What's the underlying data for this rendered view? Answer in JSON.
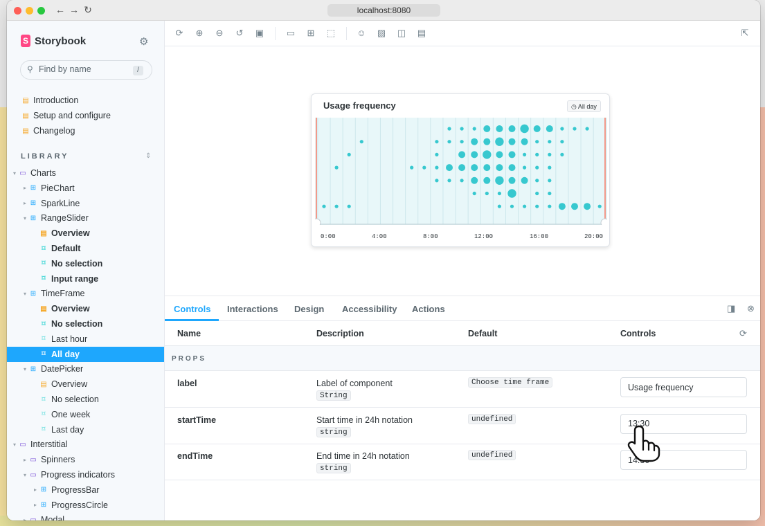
{
  "browser": {
    "url": "localhost:8080"
  },
  "sidebar": {
    "brand": "Storybook",
    "search_placeholder": "Find by name",
    "search_shortcut": "/",
    "docs": [
      {
        "label": "Introduction"
      },
      {
        "label": "Setup and configure"
      },
      {
        "label": "Changelog"
      }
    ],
    "library_header": "LIBRARY",
    "tree": [
      {
        "label": "Charts",
        "kind": "folder",
        "depth": 0,
        "expanded": true
      },
      {
        "label": "PieChart",
        "kind": "component",
        "depth": 1,
        "expanded": false
      },
      {
        "label": "SparkLine",
        "kind": "component",
        "depth": 1,
        "expanded": false
      },
      {
        "label": "RangeSlider",
        "kind": "component",
        "depth": 1,
        "expanded": true
      },
      {
        "label": "Overview",
        "kind": "doc",
        "depth": 2,
        "bold": true
      },
      {
        "label": "Default",
        "kind": "story",
        "depth": 2,
        "bold": true
      },
      {
        "label": "No selection",
        "kind": "story",
        "depth": 2,
        "bold": true
      },
      {
        "label": "Input range",
        "kind": "story",
        "depth": 2,
        "bold": true
      },
      {
        "label": "TimeFrame",
        "kind": "component",
        "depth": 1,
        "expanded": true
      },
      {
        "label": "Overview",
        "kind": "doc",
        "depth": 2,
        "bold": true
      },
      {
        "label": "No selection",
        "kind": "story",
        "depth": 2,
        "bold": true
      },
      {
        "label": "Last hour",
        "kind": "story",
        "depth": 2
      },
      {
        "label": "All day",
        "kind": "story",
        "depth": 2,
        "selected": true
      },
      {
        "label": "DatePicker",
        "kind": "component",
        "depth": 1,
        "expanded": true
      },
      {
        "label": "Overview",
        "kind": "doc",
        "depth": 2
      },
      {
        "label": "No selection",
        "kind": "story",
        "depth": 2
      },
      {
        "label": "One week",
        "kind": "story",
        "depth": 2
      },
      {
        "label": "Last day",
        "kind": "story",
        "depth": 2
      },
      {
        "label": "Interstitial",
        "kind": "folder",
        "depth": 0,
        "expanded": true
      },
      {
        "label": "Spinners",
        "kind": "folder",
        "depth": 1,
        "expanded": false
      },
      {
        "label": "Progress indicators",
        "kind": "folder",
        "depth": 1,
        "expanded": true
      },
      {
        "label": "ProgressBar",
        "kind": "component",
        "depth": 2,
        "expanded": false
      },
      {
        "label": "ProgressCircle",
        "kind": "component",
        "depth": 2,
        "expanded": false
      },
      {
        "label": "Modal",
        "kind": "folder",
        "depth": 1,
        "expanded": false
      }
    ]
  },
  "preview": {
    "card_title": "Usage frequency",
    "card_badge": "All day",
    "x_ticks": [
      "0:00",
      "4:00",
      "8:00",
      "12:00",
      "16:00",
      "20:00"
    ]
  },
  "chart_data": {
    "type": "scatter",
    "title": "Usage frequency",
    "x_unit": "hour",
    "xlim": [
      0,
      23
    ],
    "x_ticks": [
      "0:00",
      "4:00",
      "8:00",
      "12:00",
      "16:00",
      "20:00"
    ],
    "y_unit": "row",
    "rows": 7,
    "points": [
      {
        "x": 10,
        "row": 0,
        "size": 1
      },
      {
        "x": 11,
        "row": 0,
        "size": 1
      },
      {
        "x": 12,
        "row": 0,
        "size": 1
      },
      {
        "x": 13,
        "row": 0,
        "size": 2
      },
      {
        "x": 14,
        "row": 0,
        "size": 2
      },
      {
        "x": 15,
        "row": 0,
        "size": 2
      },
      {
        "x": 16,
        "row": 0,
        "size": 3
      },
      {
        "x": 17,
        "row": 0,
        "size": 2
      },
      {
        "x": 18,
        "row": 0,
        "size": 2
      },
      {
        "x": 19,
        "row": 0,
        "size": 1
      },
      {
        "x": 20,
        "row": 0,
        "size": 1
      },
      {
        "x": 21,
        "row": 0,
        "size": 1
      },
      {
        "x": 3,
        "row": 1,
        "size": 1
      },
      {
        "x": 9,
        "row": 1,
        "size": 1
      },
      {
        "x": 10,
        "row": 1,
        "size": 1
      },
      {
        "x": 11,
        "row": 1,
        "size": 1
      },
      {
        "x": 12,
        "row": 1,
        "size": 2
      },
      {
        "x": 13,
        "row": 1,
        "size": 2
      },
      {
        "x": 14,
        "row": 1,
        "size": 3
      },
      {
        "x": 15,
        "row": 1,
        "size": 2
      },
      {
        "x": 16,
        "row": 1,
        "size": 2
      },
      {
        "x": 17,
        "row": 1,
        "size": 1
      },
      {
        "x": 18,
        "row": 1,
        "size": 1
      },
      {
        "x": 19,
        "row": 1,
        "size": 1
      },
      {
        "x": 2,
        "row": 2,
        "size": 1
      },
      {
        "x": 9,
        "row": 2,
        "size": 1
      },
      {
        "x": 11,
        "row": 2,
        "size": 2
      },
      {
        "x": 12,
        "row": 2,
        "size": 2
      },
      {
        "x": 13,
        "row": 2,
        "size": 3
      },
      {
        "x": 14,
        "row": 2,
        "size": 2
      },
      {
        "x": 15,
        "row": 2,
        "size": 2
      },
      {
        "x": 16,
        "row": 2,
        "size": 1
      },
      {
        "x": 17,
        "row": 2,
        "size": 1
      },
      {
        "x": 18,
        "row": 2,
        "size": 1
      },
      {
        "x": 19,
        "row": 2,
        "size": 1
      },
      {
        "x": 1,
        "row": 3,
        "size": 1
      },
      {
        "x": 7,
        "row": 3,
        "size": 1
      },
      {
        "x": 8,
        "row": 3,
        "size": 1
      },
      {
        "x": 9,
        "row": 3,
        "size": 1
      },
      {
        "x": 10,
        "row": 3,
        "size": 2
      },
      {
        "x": 11,
        "row": 3,
        "size": 2
      },
      {
        "x": 12,
        "row": 3,
        "size": 2
      },
      {
        "x": 13,
        "row": 3,
        "size": 2
      },
      {
        "x": 14,
        "row": 3,
        "size": 2
      },
      {
        "x": 15,
        "row": 3,
        "size": 2
      },
      {
        "x": 16,
        "row": 3,
        "size": 1
      },
      {
        "x": 17,
        "row": 3,
        "size": 1
      },
      {
        "x": 18,
        "row": 3,
        "size": 1
      },
      {
        "x": 9,
        "row": 4,
        "size": 1
      },
      {
        "x": 10,
        "row": 4,
        "size": 1
      },
      {
        "x": 11,
        "row": 4,
        "size": 1
      },
      {
        "x": 12,
        "row": 4,
        "size": 2
      },
      {
        "x": 13,
        "row": 4,
        "size": 2
      },
      {
        "x": 14,
        "row": 4,
        "size": 3
      },
      {
        "x": 15,
        "row": 4,
        "size": 2
      },
      {
        "x": 16,
        "row": 4,
        "size": 2
      },
      {
        "x": 17,
        "row": 4,
        "size": 1
      },
      {
        "x": 18,
        "row": 4,
        "size": 1
      },
      {
        "x": 12,
        "row": 5,
        "size": 1
      },
      {
        "x": 13,
        "row": 5,
        "size": 1
      },
      {
        "x": 14,
        "row": 5,
        "size": 1
      },
      {
        "x": 15,
        "row": 5,
        "size": 3
      },
      {
        "x": 17,
        "row": 5,
        "size": 1
      },
      {
        "x": 18,
        "row": 5,
        "size": 1
      },
      {
        "x": 0,
        "row": 6,
        "size": 1
      },
      {
        "x": 1,
        "row": 6,
        "size": 1
      },
      {
        "x": 2,
        "row": 6,
        "size": 1
      },
      {
        "x": 14,
        "row": 6,
        "size": 1
      },
      {
        "x": 15,
        "row": 6,
        "size": 1
      },
      {
        "x": 16,
        "row": 6,
        "size": 1
      },
      {
        "x": 17,
        "row": 6,
        "size": 1
      },
      {
        "x": 18,
        "row": 6,
        "size": 1
      },
      {
        "x": 19,
        "row": 6,
        "size": 2
      },
      {
        "x": 20,
        "row": 6,
        "size": 2
      },
      {
        "x": 21,
        "row": 6,
        "size": 2
      },
      {
        "x": 22,
        "row": 6,
        "size": 1
      }
    ],
    "selection": [
      0,
      23
    ],
    "colors": {
      "points": "#37c8cf",
      "range_edge": "#f2998a",
      "plot_bg": "#e8f7f9"
    }
  },
  "addons": {
    "tabs": [
      "Controls",
      "Interactions",
      "Design",
      "Accessibility",
      "Actions"
    ],
    "active_tab": "Controls",
    "columns": {
      "name": "Name",
      "description": "Description",
      "default": "Default",
      "controls": "Controls"
    },
    "section": "PROPS",
    "rows": [
      {
        "name": "label",
        "description": "Label of component",
        "type": "String",
        "default": "Choose time frame",
        "value": "Usage frequency"
      },
      {
        "name": "startTime",
        "description": "Start time in 24h notation",
        "type": "string",
        "default": "undefined",
        "value": "13:30"
      },
      {
        "name": "endTime",
        "description": "End time in 24h notation",
        "type": "string",
        "default": "undefined",
        "value": "14:30"
      }
    ]
  },
  "colors": {
    "accent": "#1ea7fd",
    "brand": "#ff4785",
    "text": "#2e3438"
  }
}
